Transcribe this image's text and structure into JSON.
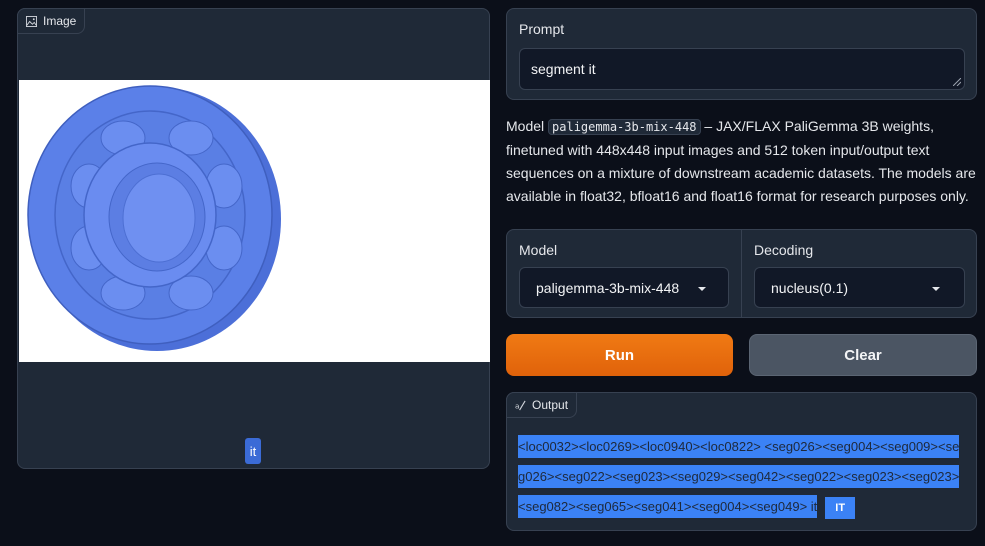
{
  "image_panel": {
    "label": "Image",
    "annotation_label": "it"
  },
  "prompt": {
    "label": "Prompt",
    "value": "segment it"
  },
  "description": {
    "prefix": "Model",
    "model_code": "paligemma-3b-mix-448",
    "text": " – JAX/FLAX PaliGemma 3B weights, finetuned with 448x448 input images and 512 token input/output text sequences on a mixture of downstream academic datasets. The models are available in float32, bfloat16 and float16 format for research purposes only."
  },
  "model_select": {
    "label": "Model",
    "value": "paligemma-3b-mix-448"
  },
  "decoding_select": {
    "label": "Decoding",
    "value": "nucleus(0.1)"
  },
  "buttons": {
    "run": "Run",
    "clear": "Clear"
  },
  "output": {
    "label": "Output",
    "text": "<loc0032><loc0269><loc0940><loc0822> <seg026><seg004><seg009><seg026><seg022><seg023><seg029><seg042><seg022><seg023><seg023><seg082><seg065><seg041><seg004><seg049> it",
    "tag": "IT"
  },
  "colors": {
    "background": "#0b0f19",
    "panel": "#1f2937",
    "run_button": "#ea6b0c",
    "clear_button": "#4b5563",
    "highlight": "#3b82f6",
    "mask": "#5b7fe6"
  }
}
